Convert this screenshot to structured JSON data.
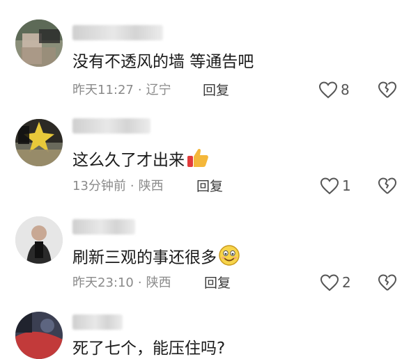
{
  "comments": [
    {
      "text": "没有不透风的墙  等通告吧",
      "time": "昨天11:27",
      "location": "辽宁",
      "reply": "回复",
      "likes": "8"
    },
    {
      "text": "这么久了才出来",
      "emoji": "thumbs-up-icon",
      "time": "13分钟前",
      "location": "陕西",
      "reply": "回复",
      "likes": "1"
    },
    {
      "text": "刷新三观的事还很多",
      "emoji": "smiley-face-icon",
      "time": "昨天23:10",
      "location": "陕西",
      "reply": "回复",
      "likes": "2"
    },
    {
      "text": "死了七个，能压住吗?"
    }
  ],
  "separator": "·",
  "colors": {
    "meta": "#8a8a8a",
    "text": "#1a1a1a",
    "icon": "#555555"
  }
}
